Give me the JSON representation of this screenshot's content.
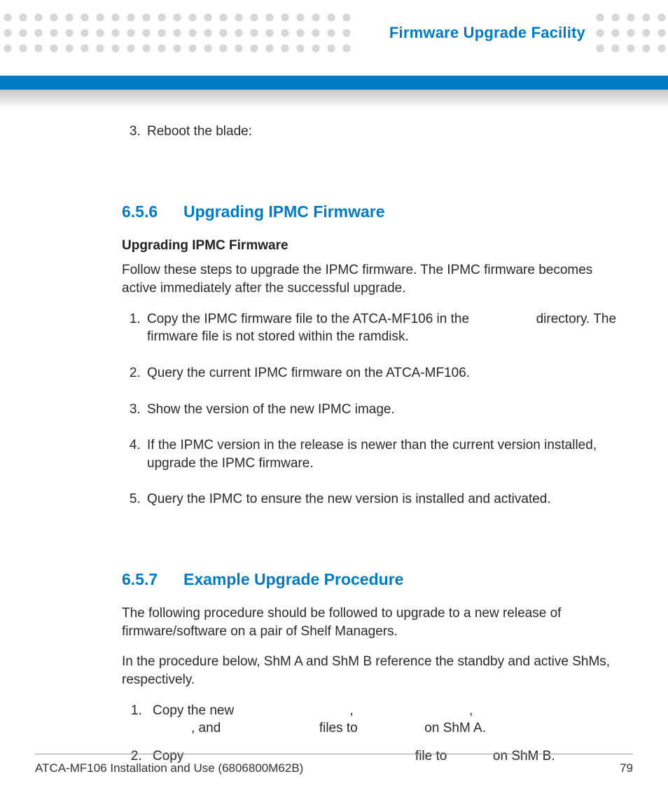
{
  "header": {
    "title": "Firmware Upgrade Facility"
  },
  "topList": {
    "start": 3,
    "item3": "Reboot the blade:"
  },
  "sec656": {
    "num": "6.5.6",
    "title": "Upgrading IPMC Firmware",
    "subhead": "Upgrading IPMC Firmware",
    "intro": "Follow these steps to upgrade the IPMC firmware. The IPMC firmware becomes active immediately after the successful upgrade.",
    "steps": {
      "s1a": "Copy the IPMC firmware file to the ATCA-MF106 in the ",
      "s1b": " directory. The firmware file is not stored within the ramdisk.",
      "s2": "Query the current IPMC firmware on the ATCA-MF106.",
      "s3": "Show the version of the new IPMC image.",
      "s4": "If the IPMC version in the release is newer than the current version installed, upgrade the IPMC firmware.",
      "s5": "Query the IPMC to ensure the new version is installed and activated."
    }
  },
  "sec657": {
    "num": "6.5.7",
    "title": "Example Upgrade Procedure",
    "p1": "The following procedure should be followed to upgrade to a new release of firmware/software on a pair of Shelf Managers.",
    "p2": "In the procedure below, ShM A and ShM B reference the standby and active ShMs, respectively.",
    "steps": {
      "s1a": "Copy the new ",
      "s1b": ", ",
      "s1c": ", ",
      "s1d": ", and ",
      "s1e": " files to ",
      "s1f": " on ShM A.",
      "s2a": "Copy ",
      "s2b": " file to ",
      "s2c": " on ShM B."
    }
  },
  "footer": {
    "left": "ATCA-MF106 Installation and Use (6806800M62B)",
    "right": "79"
  }
}
